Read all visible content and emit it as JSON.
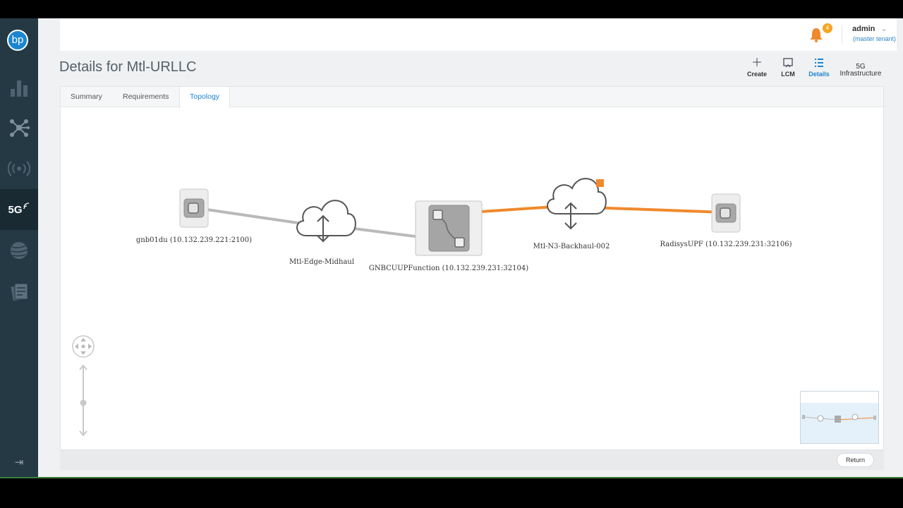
{
  "app": {
    "logo_text": "bp"
  },
  "sidebar": {
    "items": [
      {
        "name": "analytics",
        "icon": "bar-chart-icon"
      },
      {
        "name": "topology",
        "icon": "network-icon"
      },
      {
        "name": "wireless",
        "icon": "broadcast-icon"
      },
      {
        "name": "5g",
        "label": "5G",
        "icon": "5g-icon",
        "active": true
      },
      {
        "name": "globe",
        "icon": "globe-icon"
      },
      {
        "name": "catalog",
        "icon": "catalog-icon"
      }
    ],
    "collapse_icon": "collapse-right-icon"
  },
  "header": {
    "notifications_count": "4",
    "user": "admin",
    "tenant": "(master tenant)"
  },
  "page": {
    "title": "Details for Mtl-URLLC"
  },
  "toolbar": [
    {
      "label": "Create",
      "icon": "plus-icon"
    },
    {
      "label": "LCM",
      "icon": "lcm-icon"
    },
    {
      "label": "Details",
      "icon": "list-icon",
      "active": true
    },
    {
      "label_line1": "5G",
      "label_line2": "Infrastructure"
    }
  ],
  "tabs": [
    {
      "label": "Summary"
    },
    {
      "label": "Requirements"
    },
    {
      "label": "Topology",
      "active": true
    }
  ],
  "topology": {
    "nodes": [
      {
        "label": "gnb01du (10.132.239.221:2100)",
        "type": "function"
      },
      {
        "label": "Mtl-Edge-Midhaul",
        "type": "network"
      },
      {
        "label": "GNBCUUPFunction (10.132.239.231:32104)",
        "type": "function-composite"
      },
      {
        "label": "Mtl-N3-Backhaul-002",
        "type": "network"
      },
      {
        "label": "RadisysUPF (10.132.239.231:32106)",
        "type": "function"
      }
    ],
    "links": [
      {
        "from": "gnb01du",
        "to": "Mtl-Edge-Midhaul",
        "color": "#b9b9b9"
      },
      {
        "from": "Mtl-Edge-Midhaul",
        "to": "GNBCUUPFunction",
        "color": "#b9b9b9"
      },
      {
        "from": "GNBCUUPFunction",
        "to": "Mtl-N3-Backhaul-002",
        "color": "#f0892c"
      },
      {
        "from": "Mtl-N3-Backhaul-002",
        "to": "RadisysUPF",
        "color": "#f0892c"
      }
    ],
    "highlight_color": "#f0892c"
  },
  "footer": {
    "return_label": "Return"
  }
}
